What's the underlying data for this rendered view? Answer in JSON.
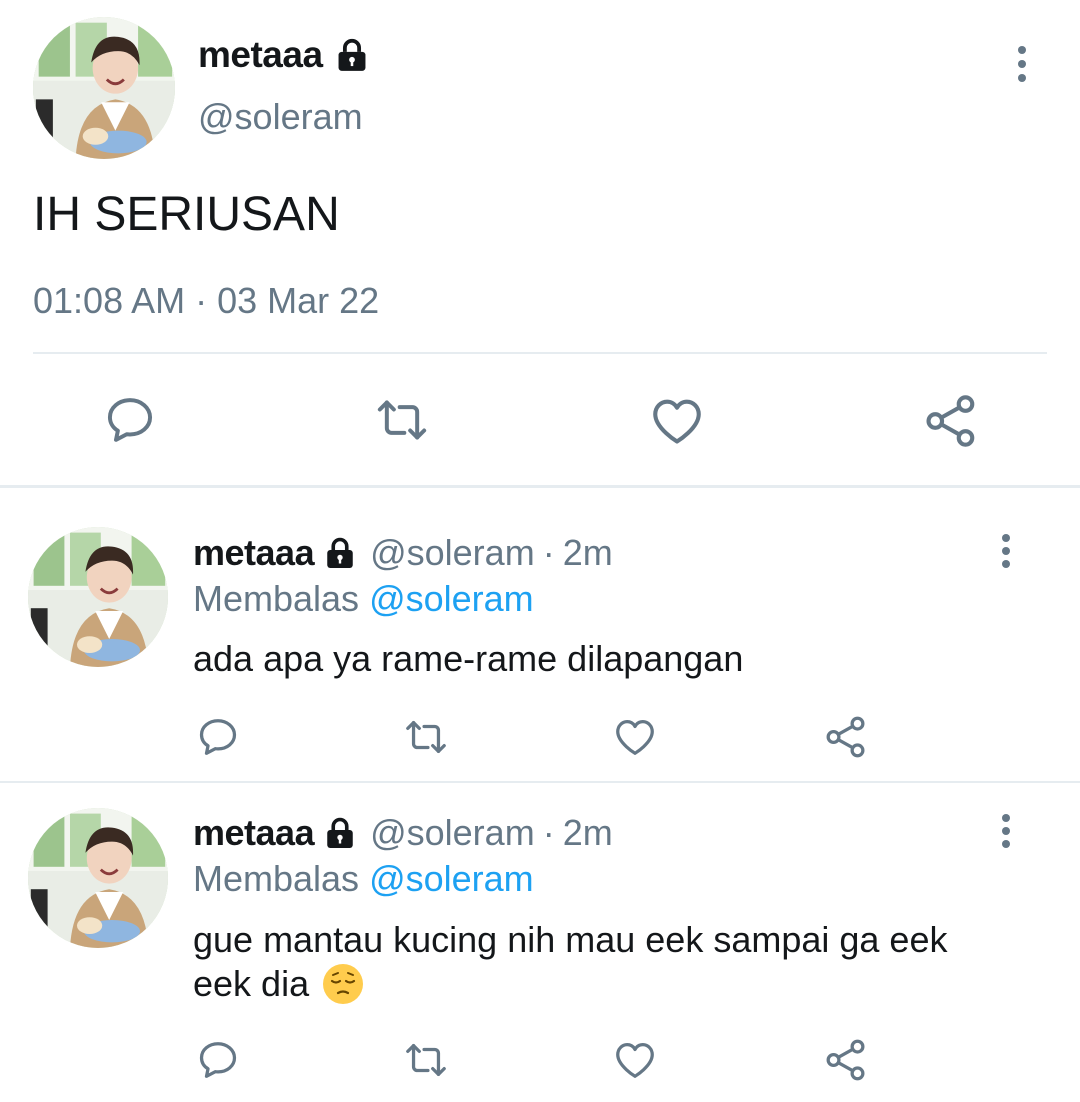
{
  "main_tweet": {
    "display_name": "metaaa",
    "handle": "@soleram",
    "text": "IH SERIUSAN",
    "time": "01:08 AM",
    "separator": "·",
    "date": "03 Mar 22"
  },
  "replies": [
    {
      "display_name": "metaaa",
      "handle": "@soleram",
      "separator": "·",
      "age": "2m",
      "replying_label": "Membalas",
      "replying_to": "@soleram",
      "text": "ada apa ya rame-rame dilapangan"
    },
    {
      "display_name": "metaaa",
      "handle": "@soleram",
      "separator": "·",
      "age": "2m",
      "replying_label": "Membalas",
      "replying_to": "@soleram",
      "text_line1": "gue mantau kucing nih mau eek sampai ga eek",
      "text_line2": "eek dia",
      "emoji": "pensive-face"
    }
  ],
  "icons": {
    "reply": "reply-icon",
    "retweet": "retweet-icon",
    "like": "like-icon",
    "share": "share-icon",
    "more": "more-vertical-icon",
    "protected": "lock-icon"
  },
  "colors": {
    "text": "#14171a",
    "muted": "#657786",
    "link": "#1da1f2",
    "divider": "#e6ecf0"
  }
}
